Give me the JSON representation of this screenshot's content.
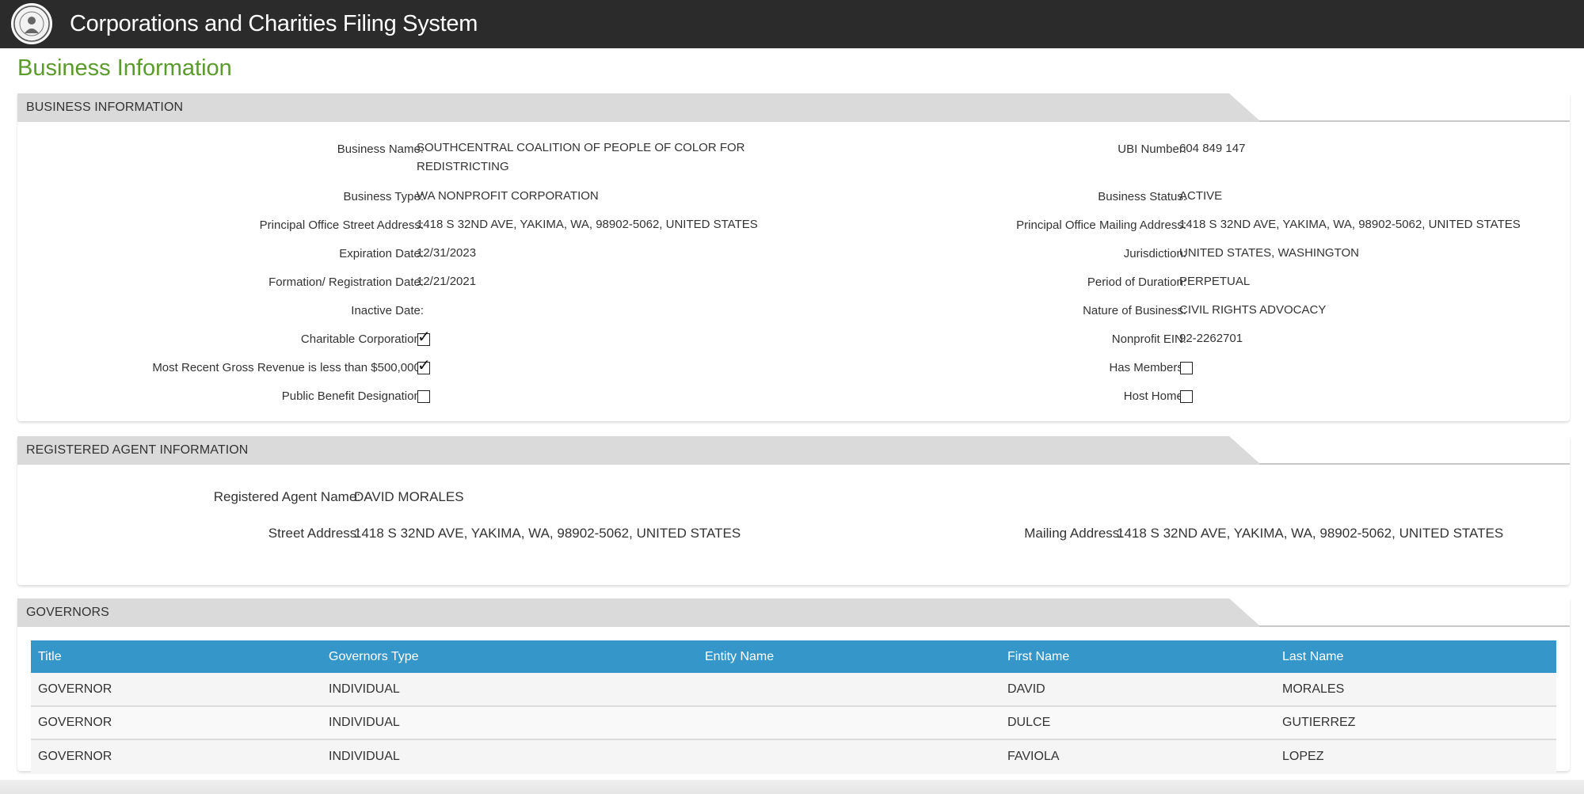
{
  "header": {
    "app_title": "Corporations and Charities Filing System",
    "logo": "state-seal-icon"
  },
  "page_title": "Business Information",
  "business_info": {
    "section_title": "BUSINESS INFORMATION",
    "left": {
      "business_name_label": "Business Name:",
      "business_name": "SOUTHCENTRAL COALITION OF PEOPLE OF COLOR FOR REDISTRICTING",
      "business_type_label": "Business Type:",
      "business_type": "WA NONPROFIT CORPORATION",
      "principal_street_label": "Principal Office Street Address:",
      "principal_street": "1418 S 32ND AVE, YAKIMA, WA, 98902-5062, UNITED STATES",
      "expiration_label": "Expiration Date:",
      "expiration": "12/31/2023",
      "formation_label": "Formation/ Registration Date:",
      "formation": "12/21/2021",
      "inactive_label": "Inactive Date:",
      "inactive": "",
      "charitable_label": "Charitable Corporation:",
      "charitable_checked": true,
      "revenue_label": "Most Recent Gross Revenue is less than $500,000:",
      "revenue_checked": true,
      "public_benefit_label": "Public Benefit Designation:",
      "public_benefit_checked": false
    },
    "right": {
      "ubi_label": "UBI Number:",
      "ubi": "604 849 147",
      "status_label": "Business Status:",
      "status": "ACTIVE",
      "mailing_label": "Principal Office Mailing Address:",
      "mailing": "1418 S 32ND AVE, YAKIMA, WA, 98902-5062, UNITED STATES",
      "jurisdiction_label": "Jurisdiction:",
      "jurisdiction": "UNITED STATES, WASHINGTON",
      "duration_label": "Period of Duration:",
      "duration": "PERPETUAL",
      "nature_label": "Nature of Business:",
      "nature": "CIVIL RIGHTS ADVOCACY",
      "ein_label": "Nonprofit EIN:",
      "ein": "92-2262701",
      "members_label": "Has Members:",
      "members_checked": false,
      "host_home_label": "Host Home:",
      "host_home_checked": false
    }
  },
  "registered_agent": {
    "section_title": "REGISTERED AGENT INFORMATION",
    "name_label": "Registered Agent Name:",
    "name": "DAVID MORALES",
    "street_label": "Street Address:",
    "street": "1418 S 32ND AVE, YAKIMA, WA, 98902-5062, UNITED STATES",
    "mailing_label": "Mailing Address:",
    "mailing": "1418 S 32ND AVE, YAKIMA, WA, 98902-5062, UNITED STATES"
  },
  "governors": {
    "section_title": "GOVERNORS",
    "columns": [
      "Title",
      "Governors Type",
      "Entity Name",
      "First Name",
      "Last Name"
    ],
    "rows": [
      [
        "GOVERNOR",
        "INDIVIDUAL",
        "",
        "DAVID",
        "MORALES"
      ],
      [
        "GOVERNOR",
        "INDIVIDUAL",
        "",
        "DULCE",
        "GUTIERREZ"
      ],
      [
        "GOVERNOR",
        "INDIVIDUAL",
        "",
        "FAVIOLA",
        "LOPEZ"
      ]
    ]
  },
  "colors": {
    "header_bg": "#2b2b2b",
    "page_title": "#5b9a2c",
    "section_tab": "#dadada",
    "table_header": "#3596c9"
  }
}
